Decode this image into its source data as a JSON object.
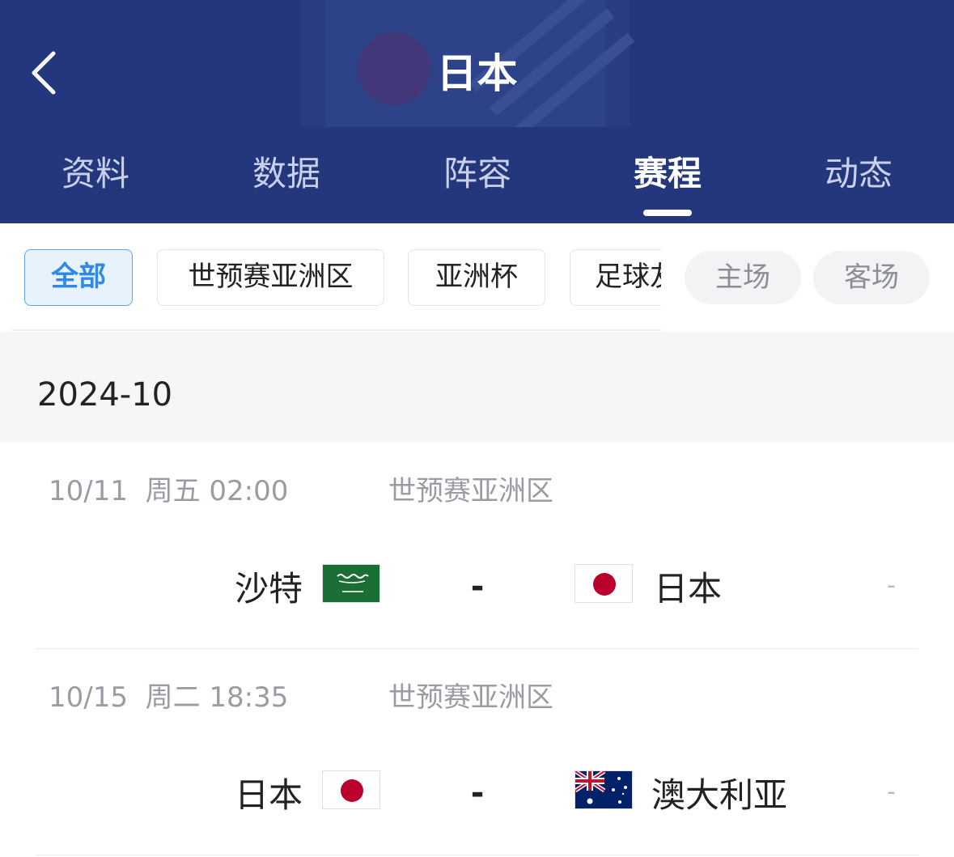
{
  "header": {
    "title": "日本"
  },
  "tabs": [
    {
      "label": "资料",
      "active": false
    },
    {
      "label": "数据",
      "active": false
    },
    {
      "label": "阵容",
      "active": false
    },
    {
      "label": "赛程",
      "active": true
    },
    {
      "label": "动态",
      "active": false
    }
  ],
  "filters": {
    "competitions": [
      {
        "label": "全部",
        "active": true
      },
      {
        "label": "世预赛亚洲区",
        "active": false
      },
      {
        "label": "亚洲杯",
        "active": false
      },
      {
        "label": "足球友",
        "active": false
      }
    ],
    "venues": [
      {
        "label": "主场"
      },
      {
        "label": "客场"
      }
    ]
  },
  "schedule": {
    "month": "2024-10",
    "matches": [
      {
        "date": "10/11  周五 02:00",
        "competition": "世预赛亚洲区",
        "home": "沙特",
        "home_flag": "saudi-arabia-flag",
        "score": "-",
        "away": "日本",
        "away_flag": "japan-flag",
        "odds": "-"
      },
      {
        "date": "10/15  周二 18:35",
        "competition": "世预赛亚洲区",
        "home": "日本",
        "home_flag": "japan-flag",
        "score": "-",
        "away": "澳大利亚",
        "away_flag": "australia-flag",
        "odds": "-"
      }
    ]
  },
  "colors": {
    "header_bg": "#24367c",
    "accent_blue": "#2f8ae6",
    "muted_text": "#9a9ca3"
  }
}
